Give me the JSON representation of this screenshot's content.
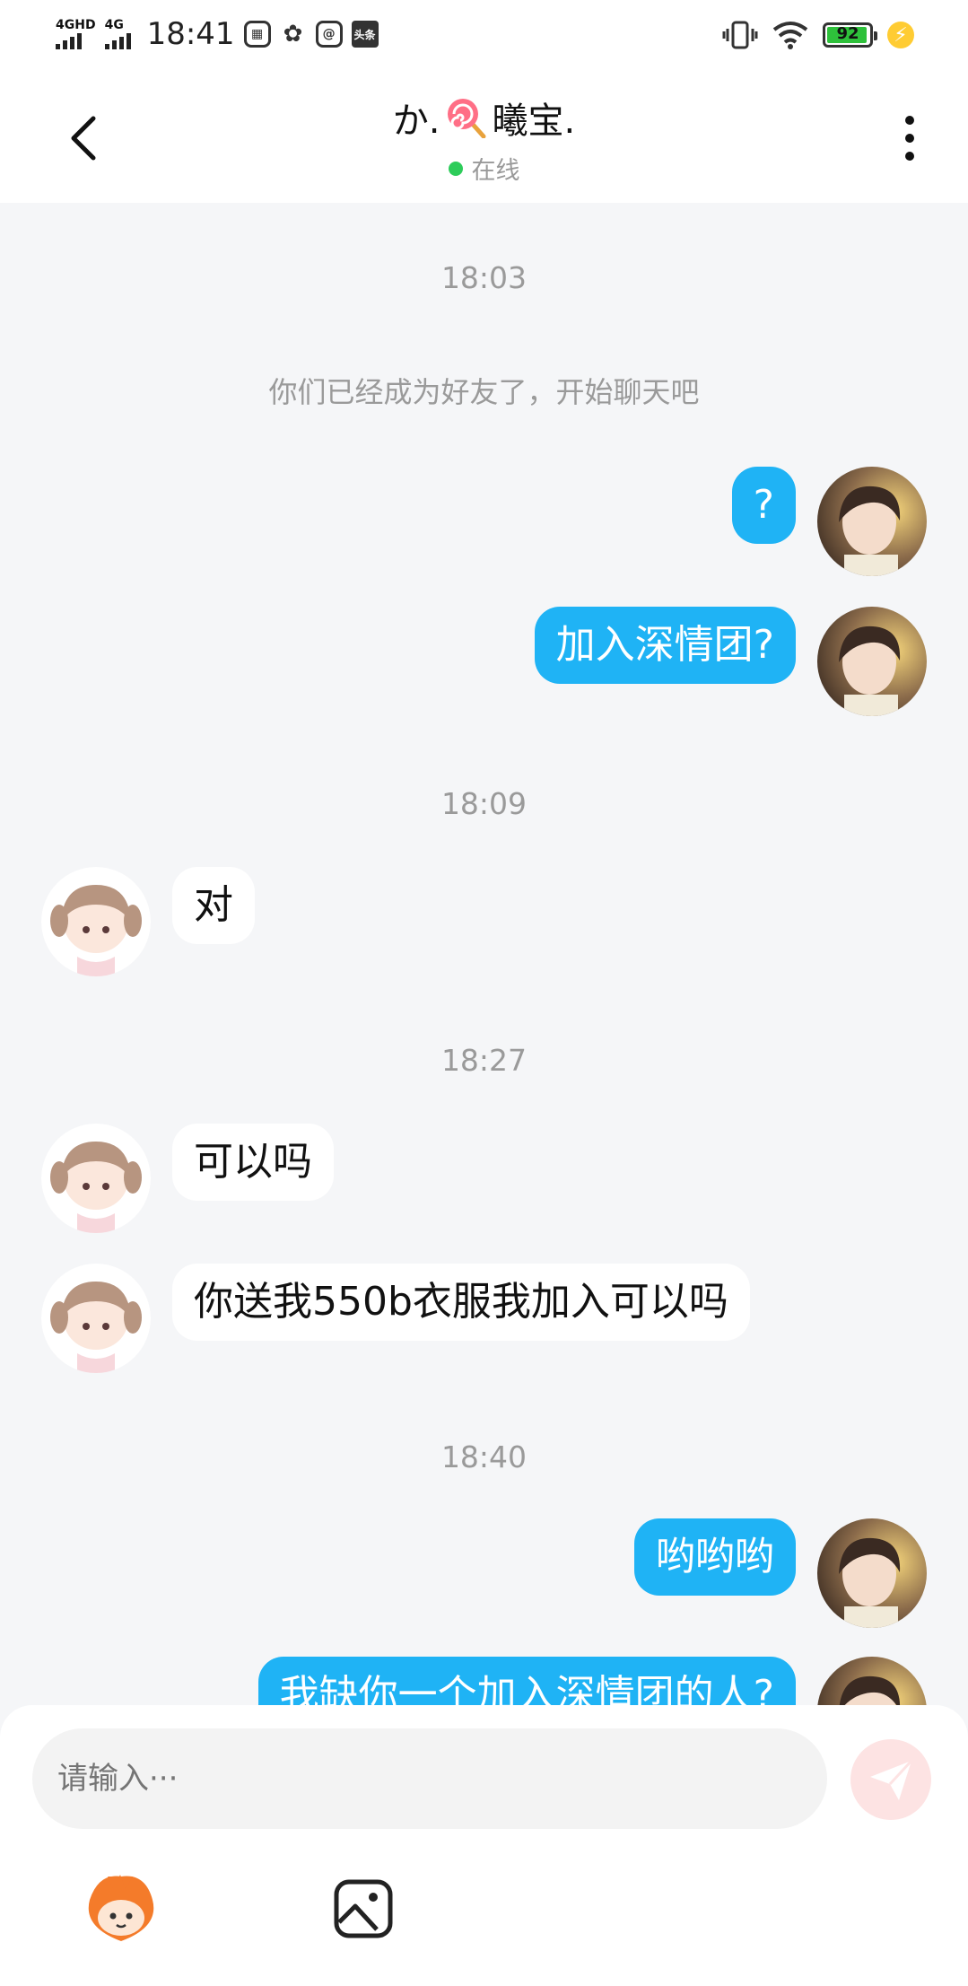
{
  "status_bar": {
    "signal1": "4GHD",
    "signal2": "4G",
    "time": "18:41",
    "app_icons": [
      "app-icon",
      "wechat-icon",
      "at-icon",
      "toutiao-icon"
    ],
    "toutiao_label": "头条",
    "battery": "92"
  },
  "header": {
    "title_prefix": "か.",
    "title_suffix": "曦宝.",
    "online_status": "在线"
  },
  "chat": {
    "timestamps": [
      "18:03",
      "18:09",
      "18:27",
      "18:40"
    ],
    "system_message": "你们已经成为好友了，开始聊天吧",
    "messages": [
      {
        "side": "out",
        "text": "?"
      },
      {
        "side": "out",
        "text": "加入深情团?"
      },
      {
        "side": "in",
        "text": "对"
      },
      {
        "side": "in",
        "text": "可以吗"
      },
      {
        "side": "in",
        "text": "你送我550b衣服我加入可以吗"
      },
      {
        "side": "out",
        "text": "哟哟哟"
      },
      {
        "side": "out",
        "text": "我缺你一个加入深情团的人?"
      }
    ]
  },
  "input": {
    "placeholder": "请输入···"
  },
  "colors": {
    "outgoing_bubble": "#1fb3f5",
    "incoming_bubble": "#ffffff",
    "online_dot": "#2dcc5a",
    "send_button": "#fde3e3"
  }
}
